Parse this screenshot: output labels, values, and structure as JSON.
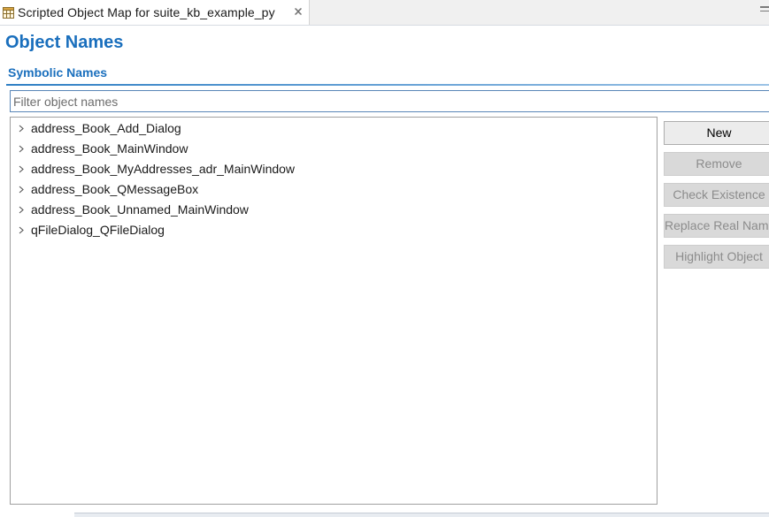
{
  "editor_tab": {
    "title": "Scripted Object Map for suite_kb_example_py",
    "icon": "object-map-icon",
    "close_icon": "close-icon"
  },
  "page": {
    "title": "Object Names"
  },
  "section": {
    "title": "Symbolic Names"
  },
  "filter": {
    "placeholder": "Filter object names",
    "value": ""
  },
  "tree": {
    "items": [
      {
        "label": "address_Book_Add_Dialog",
        "expanded": false
      },
      {
        "label": "address_Book_MainWindow",
        "expanded": false
      },
      {
        "label": "address_Book_MyAddresses_adr_MainWindow",
        "expanded": false
      },
      {
        "label": "address_Book_QMessageBox",
        "expanded": false
      },
      {
        "label": "address_Book_Unnamed_MainWindow",
        "expanded": false
      },
      {
        "label": "qFileDialog_QFileDialog",
        "expanded": false
      }
    ]
  },
  "buttons": [
    {
      "label": "New",
      "enabled": true
    },
    {
      "label": "Remove",
      "enabled": false
    },
    {
      "label": "Check Existence",
      "enabled": false
    },
    {
      "label": "Replace Real Name",
      "enabled": false
    },
    {
      "label": "Highlight Object",
      "enabled": false
    }
  ],
  "colors": {
    "heading_blue": "#1a6fbd",
    "focus_border": "#5a87b8"
  }
}
